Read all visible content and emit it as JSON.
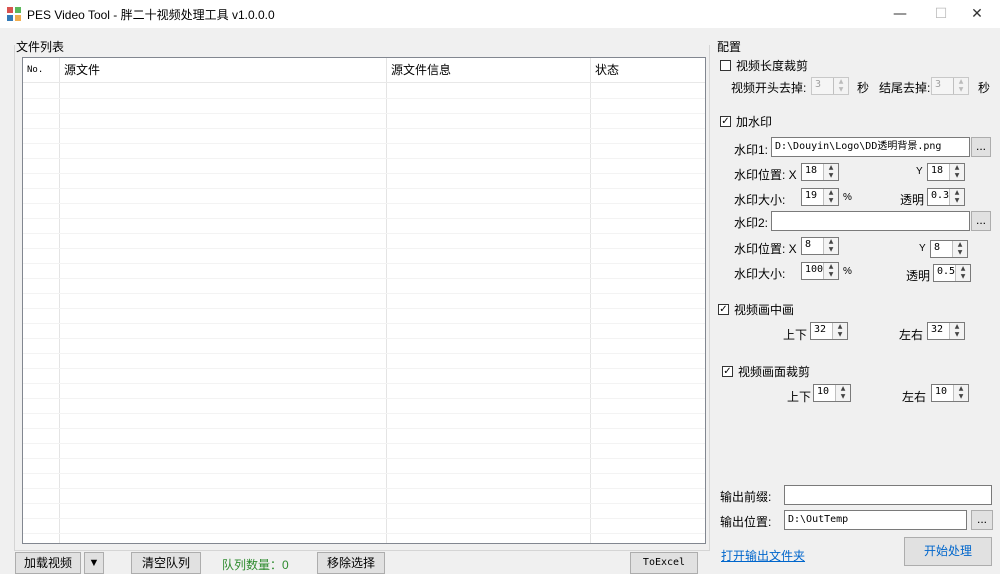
{
  "window": {
    "title": "PES Video Tool - 胖二十视频处理工具 v1.0.0.0",
    "minimize": "—",
    "maximize": "☐",
    "close": "✕"
  },
  "file_list": {
    "group_title": "文件列表",
    "columns": [
      "No.",
      "源文件",
      "源文件信息",
      "状态"
    ],
    "rows": []
  },
  "bottom_bar": {
    "add_video": "加载视频",
    "dropdown_arrow": "▼",
    "clear_queue": "清空队列",
    "queue_count_label": "队列数量：0",
    "remove_selected": "移除选择",
    "to_excel": "ToExcel"
  },
  "config": {
    "group_title": "配置",
    "trim": {
      "label": "视频长度裁剪",
      "checked": false,
      "start_label": "视频开头去掉:",
      "start_value": "3",
      "start_unit": "秒",
      "end_label": "结尾去掉:",
      "end_value": "3",
      "end_unit": "秒"
    },
    "watermark": {
      "label": "加水印",
      "checked": true,
      "wm1_label": "水印1:",
      "wm1_path": "D:\\Douyin\\Logo\\DD透明背景.png",
      "wm1_pos_label": "水印位置: X",
      "wm1_x": "18",
      "wm1_y_label": "Y",
      "wm1_y": "18",
      "wm1_size_label": "水印大小:",
      "wm1_size": "19",
      "wm1_size_unit": "%",
      "wm1_opacity_label": "透明",
      "wm1_opacity": "0.3",
      "wm2_label": "水印2:",
      "wm2_path": "",
      "wm2_pos_label": "水印位置: X",
      "wm2_x": "8",
      "wm2_y_label": "Y",
      "wm2_y": "8",
      "wm2_size_label": "水印大小:",
      "wm2_size": "100",
      "wm2_size_unit": "%",
      "wm2_opacity_label": "透明",
      "wm2_opacity": "0.5",
      "browse": "..."
    },
    "pip": {
      "label": "视频画中画",
      "checked": true,
      "updown_label": "上下",
      "updown": "32",
      "leftright_label": "左右",
      "leftright": "32"
    },
    "crop": {
      "label": "视频画面裁剪",
      "checked": true,
      "updown_label": "上下",
      "updown": "10",
      "leftright_label": "左右",
      "leftright": "10"
    },
    "output": {
      "prefix_label": "输出前缀:",
      "prefix_value": "",
      "path_label": "输出位置:",
      "path_value": "D:\\OutTemp",
      "browse": "...",
      "open_folder": "打开输出文件夹",
      "start": "开始处理"
    }
  }
}
